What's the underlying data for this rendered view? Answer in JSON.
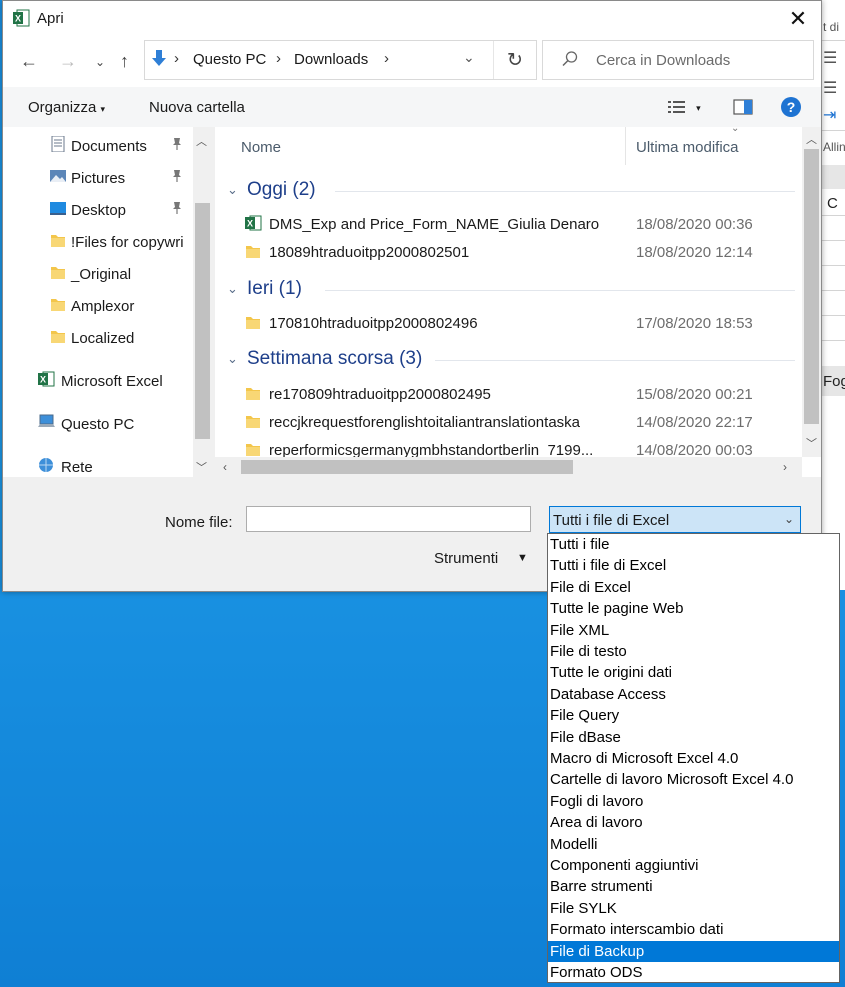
{
  "window": {
    "title": "Apri"
  },
  "address": {
    "crumbs": [
      "Questo PC",
      "Downloads"
    ]
  },
  "search": {
    "placeholder": "Cerca in Downloads"
  },
  "toolbar": {
    "organize": "Organizza",
    "new_folder": "Nuova cartella"
  },
  "navpane": {
    "items": [
      {
        "label": "Documents",
        "icon": "documents-icon",
        "pinned": true
      },
      {
        "label": "Pictures",
        "icon": "pictures-icon",
        "pinned": true
      },
      {
        "label": "Desktop",
        "icon": "desktop-icon",
        "pinned": true
      },
      {
        "label": "!Files for copywri",
        "icon": "folder-icon",
        "pinned": false
      },
      {
        "label": "_Original",
        "icon": "folder-icon",
        "pinned": false
      },
      {
        "label": "Amplexor",
        "icon": "folder-icon",
        "pinned": false
      },
      {
        "label": "Localized",
        "icon": "folder-icon",
        "pinned": false
      },
      {
        "label": "Microsoft Excel",
        "icon": "excel-icon",
        "pinned": false
      },
      {
        "label": "Questo PC",
        "icon": "computer-icon",
        "pinned": false
      },
      {
        "label": "Rete",
        "icon": "network-icon",
        "pinned": false
      }
    ]
  },
  "filelist": {
    "headers": {
      "name": "Nome",
      "modified": "Ultima modifica"
    },
    "groups": [
      {
        "label": "Oggi (2)",
        "files": [
          {
            "name": "DMS_Exp and Price_Form_NAME_Giulia Denaro",
            "date": "18/08/2020 00:36",
            "icon": "excel-file-icon"
          },
          {
            "name": "18089htraduoitpp2000802501",
            "date": "18/08/2020 12:14",
            "icon": "folder-icon"
          }
        ]
      },
      {
        "label": "Ieri (1)",
        "files": [
          {
            "name": "170810htraduoitpp2000802496",
            "date": "17/08/2020 18:53",
            "icon": "folder-icon"
          }
        ]
      },
      {
        "label": "Settimana scorsa (3)",
        "files": [
          {
            "name": "re170809htraduoitpp2000802495",
            "date": "15/08/2020 00:21",
            "icon": "folder-icon"
          },
          {
            "name": "reccjkrequestforenglishtoitaliantranslationtaska",
            "date": "14/08/2020 22:17",
            "icon": "folder-icon"
          },
          {
            "name": "reperformicsgermanygmbhstandortberlin_7199...",
            "date": "14/08/2020 00:03",
            "icon": "folder-icon"
          }
        ]
      }
    ]
  },
  "footer": {
    "filename_label": "Nome file:",
    "filename_value": "",
    "filetype_value": "Tutti i file di Excel",
    "tools_label": "Strumenti"
  },
  "filetype_options": [
    "Tutti i file",
    "Tutti i file di Excel",
    "File di Excel",
    "Tutte le pagine Web",
    "File XML",
    "File di testo",
    "Tutte le origini dati",
    "Database Access",
    "File Query",
    "File dBase",
    "Macro di Microsoft Excel 4.0",
    "Cartelle di lavoro Microsoft Excel 4.0",
    "Fogli di lavoro",
    "Area di lavoro",
    "Modelli",
    "Componenti aggiuntivi",
    "Barre strumenti",
    "File SYLK",
    "Formato interscambio dati",
    "File di Backup",
    "Formato ODS"
  ],
  "filetype_highlighted": "File di Backup",
  "background_app": {
    "texts": [
      "t di",
      "Allin",
      "C",
      "Fog"
    ]
  },
  "colors": {
    "accent": "#0078d7",
    "selection_bg": "#cce4f7",
    "group_header": "#1e3f8a",
    "desktop": "#1a8fe0"
  }
}
